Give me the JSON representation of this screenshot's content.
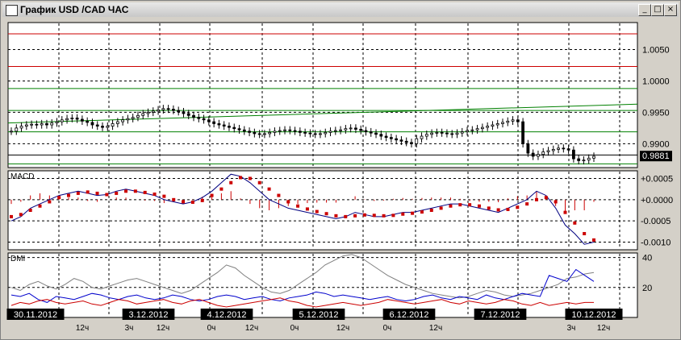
{
  "window": {
    "title": "График USD /CAD  ЧАС",
    "minimize": "_",
    "maximize": "□",
    "close": "×"
  },
  "price_panel": {
    "current_price": "0.9881"
  },
  "chart_data": [
    {
      "type": "candlestick",
      "title": "График USD /CAD  ЧАС",
      "y_ticks": [
        "1.0050",
        "1.0000",
        "0.9950",
        "0.9900"
      ],
      "y_tick_values": [
        1.005,
        1.0,
        0.995,
        0.99
      ],
      "ylim": [
        0.9862,
        1.0093
      ],
      "current_price": 0.9881,
      "horizontal_levels": [
        {
          "value": 1.0075,
          "color": "#cc0000"
        },
        {
          "value": 1.0023,
          "color": "#cc0000"
        },
        {
          "value": 0.9988,
          "color": "#008000"
        },
        {
          "value": 0.9953,
          "color": "#008000"
        },
        {
          "value": 0.9919,
          "color": "#008000"
        },
        {
          "value": 0.9882,
          "color": "#000000"
        },
        {
          "value": 0.9868,
          "color": "#008000"
        }
      ],
      "trend_line": {
        "from": [
          0,
          0.9933
        ],
        "to": [
          1,
          0.9963
        ],
        "color": "#008000"
      },
      "close_series": [
        0.992,
        0.9925,
        0.9928,
        0.993,
        0.9931,
        0.993,
        0.9932,
        0.993,
        0.9933,
        0.9935,
        0.9938,
        0.994,
        0.9941,
        0.9939,
        0.9936,
        0.9934,
        0.993,
        0.9928,
        0.9926,
        0.9928,
        0.9932,
        0.9935,
        0.9938,
        0.994,
        0.9942,
        0.9945,
        0.9948,
        0.995,
        0.9952,
        0.9954,
        0.9956,
        0.9955,
        0.9953,
        0.9951,
        0.9948,
        0.9945,
        0.9942,
        0.994,
        0.9938,
        0.9935,
        0.9932,
        0.993,
        0.9928,
        0.9926,
        0.9924,
        0.9922,
        0.992,
        0.9918,
        0.9916,
        0.9915,
        0.9916,
        0.9918,
        0.992,
        0.9921,
        0.9922,
        0.9921,
        0.992,
        0.9918,
        0.9917,
        0.9916,
        0.9915,
        0.9916,
        0.9918,
        0.992,
        0.9921,
        0.9922,
        0.9924,
        0.9925,
        0.9923,
        0.9921,
        0.9919,
        0.9917,
        0.9915,
        0.9912,
        0.991,
        0.9908,
        0.9906,
        0.9904,
        0.9902,
        0.99,
        0.9908,
        0.9912,
        0.9915,
        0.9917,
        0.9918,
        0.9917,
        0.9916,
        0.9915,
        0.9917,
        0.9919,
        0.9921,
        0.9922,
        0.9924,
        0.9926,
        0.9928,
        0.993,
        0.9932,
        0.9934,
        0.9936,
        0.9938,
        0.9935,
        0.99,
        0.9885,
        0.988,
        0.9883,
        0.9887,
        0.9889,
        0.9891,
        0.9893,
        0.9892,
        0.989,
        0.9876,
        0.9873,
        0.9874,
        0.9877,
        0.988
      ]
    },
    {
      "type": "line",
      "title": "MACD",
      "y_ticks": [
        "+0.0005",
        "+0.0000",
        "-0.0005",
        "-0.0010"
      ],
      "y_tick_values": [
        0.0005,
        0.0,
        -0.0005,
        -0.001
      ],
      "ylim": [
        -0.00118,
        0.00068
      ],
      "series": [
        {
          "role": "macd",
          "color": "#000080",
          "values": [
            -0.0005,
            -0.0004,
            -0.0002,
            -0.0001,
            0.0,
            0.0001,
            0.00015,
            0.0002,
            0.00015,
            0.0001,
            0.00012,
            0.0002,
            0.00025,
            0.0002,
            0.00015,
            0.0001,
            0.0,
            -5e-05,
            -0.0001,
            -5e-05,
            5e-05,
            0.0002,
            0.0004,
            0.0006,
            0.00055,
            0.0004,
            0.0002,
            0.0,
            -0.0001,
            -0.0002,
            -0.00025,
            -0.0003,
            -0.00035,
            -0.0004,
            -0.00045,
            -0.0004,
            -0.0003,
            -0.00035,
            -0.0004,
            -0.0004,
            -0.00035,
            -0.0003,
            -0.0003,
            -0.00025,
            -0.0002,
            -0.00015,
            -0.0001,
            -0.0001,
            -0.00015,
            -0.0002,
            -0.00025,
            -0.0003,
            -0.0002,
            -0.0001,
            0.0,
            0.0002,
            0.0001,
            -0.0002,
            -0.0006,
            -0.0008,
            -0.00105,
            -0.001
          ]
        },
        {
          "role": "signal",
          "color": "#cc0000",
          "values": [
            -0.0004,
            -0.00035,
            -0.00025,
            -0.00015,
            -5e-05,
            5e-05,
            0.0001,
            0.00015,
            0.00018,
            0.00015,
            0.00012,
            0.00015,
            0.0002,
            0.0002,
            0.00017,
            0.00013,
            8e-05,
            0.0,
            -5e-05,
            -6e-05,
            -2e-05,
            0.0001,
            0.00025,
            0.0004,
            0.00052,
            0.0005,
            0.0004,
            0.00025,
            0.0001,
            -5e-05,
            -0.00015,
            -0.00022,
            -0.00028,
            -0.00033,
            -0.00038,
            -0.0004,
            -0.00038,
            -0.00036,
            -0.00037,
            -0.00038,
            -0.00037,
            -0.00034,
            -0.00032,
            -0.00029,
            -0.00025,
            -0.0002,
            -0.00015,
            -0.00012,
            -0.00012,
            -0.00015,
            -0.0002,
            -0.00024,
            -0.00023,
            -0.00018,
            -0.0001,
            0.0,
            5e-05,
            -5e-05,
            -0.0003,
            -0.00055,
            -0.0008,
            -0.00095
          ]
        }
      ],
      "histogram": [
        -0.0001,
        -5e-05,
        0.0001,
        0.00015,
        0.0001,
        5e-05,
        5e-05,
        5e-05,
        -3e-05,
        -5e-05,
        0.0,
        5e-05,
        5e-05,
        0.0,
        -2e-05,
        -3e-05,
        -8e-05,
        -5e-05,
        -5e-05,
        1e-05,
        7e-05,
        0.0001,
        0.00015,
        0.0002,
        3e-05,
        -0.0001,
        -0.0002,
        -0.00025,
        -0.0002,
        -0.00015,
        -0.0001,
        -8e-05,
        -7e-05,
        -7e-05,
        -7e-05,
        0.0,
        8e-05,
        1e-05,
        -3e-05,
        -2e-05,
        2e-05,
        4e-05,
        2e-05,
        4e-05,
        5e-05,
        5e-05,
        5e-05,
        2e-05,
        -3e-05,
        -5e-05,
        -5e-05,
        -6e-05,
        3e-05,
        8e-05,
        0.0001,
        0.0002,
        5e-05,
        -0.00015,
        -0.0003,
        -0.00025,
        -0.00025,
        -5e-05
      ]
    },
    {
      "type": "line",
      "title": "DMI",
      "y_ticks": [
        "40",
        "20"
      ],
      "y_tick_values": [
        40,
        20
      ],
      "ylim": [
        0,
        43
      ],
      "series": [
        {
          "role": "adx",
          "color": "#808080",
          "values": [
            20,
            18,
            22,
            24,
            21,
            19,
            22,
            26,
            24,
            20,
            19,
            21,
            23,
            25,
            26,
            24,
            22,
            20,
            18,
            16,
            18,
            22,
            26,
            30,
            35,
            33,
            28,
            24,
            20,
            17,
            16,
            18,
            22,
            26,
            30,
            35,
            38,
            41,
            42,
            40,
            36,
            32,
            28,
            25,
            22,
            20,
            18,
            16,
            15,
            14,
            13,
            14,
            16,
            18,
            17,
            15,
            14,
            15,
            16,
            18,
            20,
            22,
            26,
            27,
            29,
            30
          ]
        },
        {
          "role": "plus_di",
          "color": "#0000cc",
          "values": [
            15,
            14,
            16,
            12,
            10,
            14,
            13,
            12,
            14,
            16,
            15,
            13,
            12,
            14,
            15,
            13,
            12,
            13,
            15,
            14,
            12,
            11,
            12,
            14,
            15,
            14,
            12,
            13,
            14,
            12,
            11,
            13,
            14,
            15,
            17,
            16,
            14,
            15,
            14,
            13,
            12,
            13,
            14,
            12,
            11,
            12,
            14,
            15,
            13,
            12,
            14,
            13,
            12,
            15,
            13,
            12,
            14,
            16,
            15,
            14,
            28,
            26,
            24,
            32,
            28,
            24
          ]
        },
        {
          "role": "minus_di",
          "color": "#cc0000",
          "values": [
            8,
            10,
            9,
            11,
            12,
            10,
            9,
            10,
            11,
            9,
            8,
            10,
            12,
            11,
            9,
            10,
            11,
            12,
            10,
            9,
            11,
            12,
            10,
            8,
            7,
            8,
            9,
            10,
            11,
            12,
            13,
            11,
            10,
            8,
            7,
            8,
            9,
            10,
            9,
            8,
            9,
            10,
            12,
            11,
            10,
            9,
            10,
            11,
            12,
            10,
            9,
            11,
            10,
            9,
            10,
            12,
            11,
            9,
            8,
            10,
            8,
            9,
            10,
            9,
            10,
            10
          ]
        }
      ],
      "date_labels": [
        "30.11.2012",
        "3.12.2012",
        "4.12.2012",
        "5.12.2012",
        "6.12.2012",
        "7.12.2012",
        "10.12.2012"
      ],
      "hour_labels": [
        "12ч",
        "3ч",
        "12ч",
        "0ч",
        "12ч",
        "0ч",
        "12ч",
        "0ч",
        "12ч",
        "3ч",
        "12ч"
      ]
    }
  ]
}
